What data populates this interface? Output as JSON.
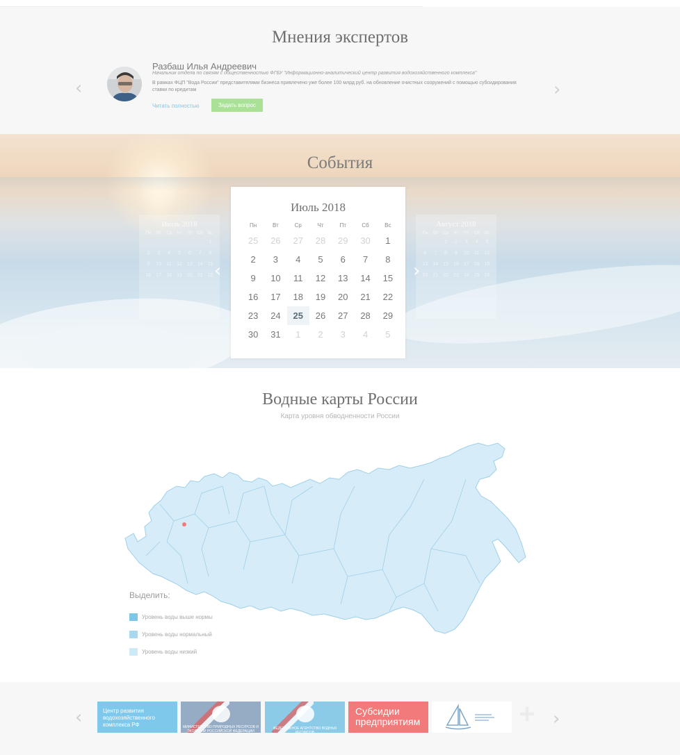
{
  "experts": {
    "title": "Мнения экспертов",
    "name": "Разбаш Илья Андреевич",
    "role": "Начальник отдела по связям с общественностью ФГБУ \"Информационно-аналитический центр развития водохозяйственного комплекса\"",
    "quote": "В рамках ФЦП \"Вода России\" представителями бизнеса привлечено уже более 100 млрд руб. на обновление очистных сооружений с помощью субсидирования ставки по кредитам",
    "read_more": "Читать полностью",
    "ask_label": "Задать вопрос",
    "prev": "‹",
    "next": "›"
  },
  "events": {
    "title": "События",
    "prev": "‹",
    "next": "›",
    "calendar": {
      "month": "Июль 2018",
      "weekdays": [
        "Пн",
        "Вт",
        "Ср",
        "Чт",
        "Пт",
        "Сб",
        "Вс"
      ],
      "days": [
        {
          "d": "25",
          "m": true
        },
        {
          "d": "26",
          "m": true
        },
        {
          "d": "27",
          "m": true
        },
        {
          "d": "28",
          "m": true
        },
        {
          "d": "29",
          "m": true
        },
        {
          "d": "30",
          "m": true
        },
        {
          "d": "1"
        },
        {
          "d": "2"
        },
        {
          "d": "3"
        },
        {
          "d": "4"
        },
        {
          "d": "5"
        },
        {
          "d": "6"
        },
        {
          "d": "7"
        },
        {
          "d": "8"
        },
        {
          "d": "9"
        },
        {
          "d": "10"
        },
        {
          "d": "11"
        },
        {
          "d": "12"
        },
        {
          "d": "13"
        },
        {
          "d": "14"
        },
        {
          "d": "15"
        },
        {
          "d": "16"
        },
        {
          "d": "17"
        },
        {
          "d": "18"
        },
        {
          "d": "19"
        },
        {
          "d": "20"
        },
        {
          "d": "21"
        },
        {
          "d": "22"
        },
        {
          "d": "23"
        },
        {
          "d": "24"
        },
        {
          "d": "25",
          "today": true
        },
        {
          "d": "26"
        },
        {
          "d": "27"
        },
        {
          "d": "28"
        },
        {
          "d": "29"
        },
        {
          "d": "30"
        },
        {
          "d": "31"
        },
        {
          "d": "1",
          "m": true
        },
        {
          "d": "2",
          "m": true
        },
        {
          "d": "3",
          "m": true
        },
        {
          "d": "4",
          "m": true
        },
        {
          "d": "5",
          "m": true
        }
      ]
    },
    "prev_calendar": {
      "month": "Июль 2018",
      "weekdays": [
        "Пн",
        "Вт",
        "Ср",
        "Чт",
        "Пт",
        "Сб",
        "Вс"
      ],
      "days": [
        "",
        "",
        "",
        "",
        "",
        "",
        "1",
        "2",
        "3",
        "4",
        "5",
        "6",
        "7",
        "8",
        "9",
        "10",
        "11",
        "12",
        "13",
        "14",
        "15",
        "16",
        "17",
        "18",
        "19",
        "20",
        "21",
        "22"
      ]
    },
    "next_calendar": {
      "month": "Август 2018",
      "weekdays": [
        "Пн",
        "Вт",
        "Ср",
        "Чт",
        "Пт",
        "Сб",
        "Вс"
      ],
      "days": [
        "",
        "",
        "1",
        "2",
        "3",
        "4",
        "5",
        "6",
        "7",
        "8",
        "9",
        "10",
        "11",
        "12",
        "13",
        "14",
        "15",
        "16",
        "17",
        "18",
        "19",
        "20",
        "21",
        "22",
        "23",
        "24",
        "25",
        "26"
      ]
    }
  },
  "maps": {
    "title": "Водные карты России",
    "subtitle": "Карта уровня обводненности России",
    "legend_title": "Выделить:",
    "legend": [
      {
        "label": "Уровень воды выше нормы",
        "color": "#7dc6e8"
      },
      {
        "label": "Уровень воды нормальный",
        "color": "#a9d9ef"
      },
      {
        "label": "Уровень воды низкий",
        "color": "#cdeaf6"
      }
    ],
    "map_fill": "#d6ecf9",
    "map_stroke": "#9fcfe8",
    "marker_color": "#f07b7b"
  },
  "partners": {
    "prev": "‹",
    "next": "›",
    "p1": "Центр развития водохозяйственного комплекса РФ",
    "p2": "МИНИСТЕРСТВО ПРИРОДНЫХ РЕСУРСОВ И ЭКОЛОГИИ РОССИЙСКОЙ ФЕДЕРАЦИИ",
    "p3": "ФЕДЕРАЛЬНОЕ АГЕНТСТВО ВОДНЫХ РЕСУРСОВ",
    "p4": "Субсидии предприятиям",
    "p6": "+"
  }
}
